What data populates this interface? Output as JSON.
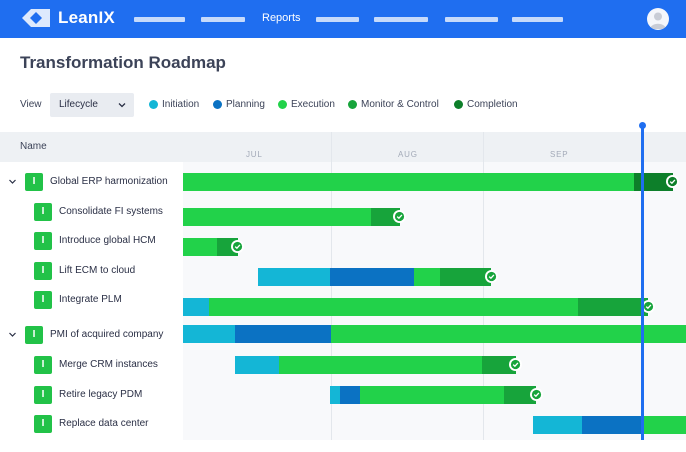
{
  "app": {
    "brand": "LeanIX"
  },
  "nav": {
    "reports_label": "Reports"
  },
  "page": {
    "title": "Transformation Roadmap"
  },
  "filters": {
    "view_label": "View",
    "view_value": "Lifecycle"
  },
  "legend": [
    {
      "label": "Initiation",
      "color": "#14b6d6"
    },
    {
      "label": "Planning",
      "color": "#0b72c3"
    },
    {
      "label": "Execution",
      "color": "#22d24a"
    },
    {
      "label": "Monitor & Control",
      "color": "#17a43b"
    },
    {
      "label": "Completion",
      "color": "#0d7f2a"
    }
  ],
  "table": {
    "name_header": "Name",
    "months": [
      "JUL",
      "AUG",
      "SEP"
    ]
  },
  "rows": [
    {
      "label": "Global ERP harmonization",
      "tag": "I",
      "expandable": true
    },
    {
      "label": "Consolidate FI systems",
      "tag": "I",
      "expandable": false
    },
    {
      "label": "Introduce global HCM",
      "tag": "I",
      "expandable": false
    },
    {
      "label": "Lift ECM to cloud",
      "tag": "I",
      "expandable": false
    },
    {
      "label": "Integrate PLM",
      "tag": "I",
      "expandable": false
    },
    {
      "label": "PMI of acquired company",
      "tag": "I",
      "expandable": true
    },
    {
      "label": "Merge CRM instances",
      "tag": "I",
      "expandable": false
    },
    {
      "label": "Retire legacy PDM",
      "tag": "I",
      "expandable": false
    },
    {
      "label": "Replace data center",
      "tag": "I",
      "expandable": false
    }
  ],
  "icons": {
    "logo": "leanix-logo-icon",
    "avatar": "user-avatar-icon",
    "expand": "chevron-down-icon",
    "dropdown": "chevron-down-icon",
    "done": "check-circle-icon"
  }
}
